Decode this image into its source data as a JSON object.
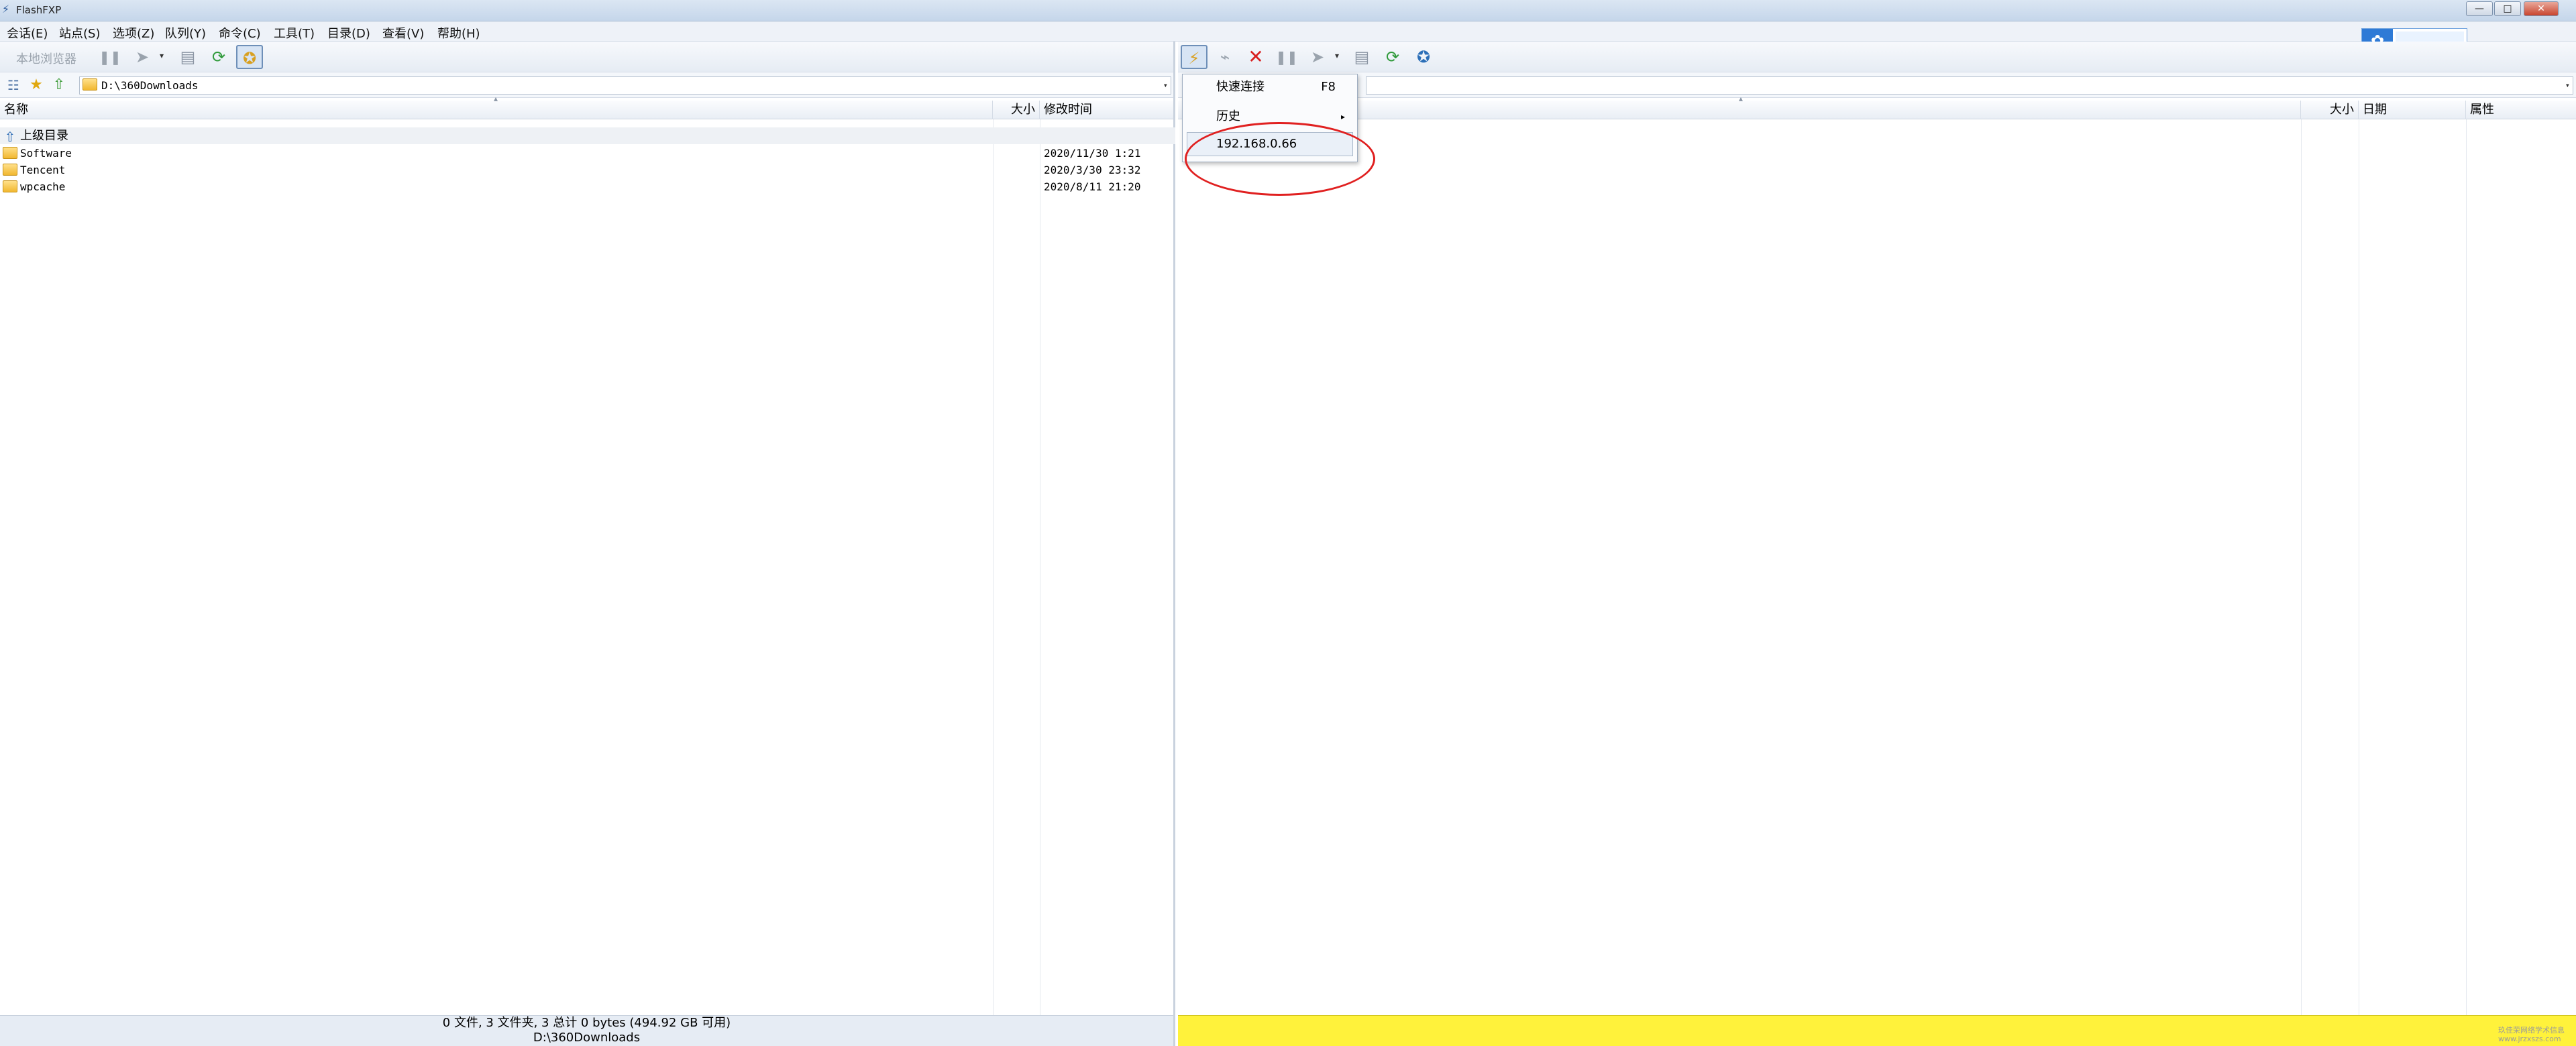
{
  "window": {
    "title": "FlashFXP",
    "minimize": "—",
    "maximize": "□",
    "close": "✕"
  },
  "menu": [
    "会话(E)",
    "站点(S)",
    "选项(Z)",
    "队列(Y)",
    "命令(C)",
    "工具(T)",
    "目录(D)",
    "查看(V)",
    "帮助(H)"
  ],
  "left": {
    "toolbar_label": "本地浏览器",
    "path": "D:\\360Downloads",
    "columns": {
      "name": "名称",
      "size": "大小",
      "modified": "修改时间"
    },
    "up_dir": "上级目录",
    "rows": [
      {
        "name": "Software",
        "modified": "2020/11/30 1:21"
      },
      {
        "name": "Tencent",
        "modified": "2020/3/30 23:32"
      },
      {
        "name": "wpcache",
        "modified": "2020/8/11 21:20"
      }
    ],
    "status_line1": "0 文件, 3 文件夹, 3 总计 0 bytes (494.92 GB 可用)",
    "status_line2": "D:\\360Downloads"
  },
  "right": {
    "path": "",
    "columns": {
      "size": "大小",
      "date": "日期",
      "attr": "属性"
    }
  },
  "dropdown": {
    "quick_connect": "快速连接",
    "quick_connect_key": "F8",
    "history": "历史",
    "history_arrow": "▸",
    "recent_host": "192.168.0.66"
  },
  "icons": {
    "pause": "❚❚",
    "transfer": "➤",
    "dropdown": "▾",
    "stop": "✕",
    "refresh": "⟳",
    "connect": "⚡",
    "disconnect": "⌁",
    "star": "★",
    "up": "⇧",
    "tree": "☷",
    "world": "✪",
    "cloud": "✿",
    "server": "▤"
  },
  "colors": {
    "status_right": "#fff23b",
    "highlight_ellipse": "#e02020",
    "stop_red": "#d81e1e"
  },
  "watermark": "玖佳荣网络学术信息 www.jrzxszs.com"
}
